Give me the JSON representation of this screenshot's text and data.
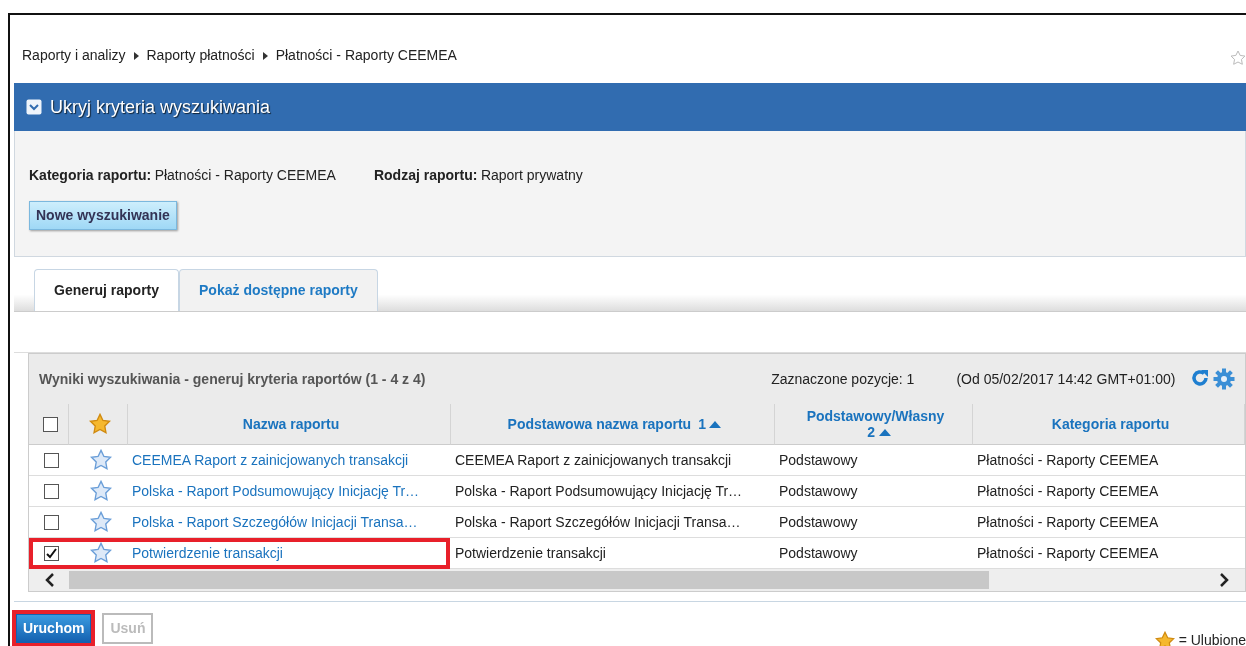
{
  "breadcrumb": [
    "Raporty i analizy",
    "Raporty płatności",
    "Płatności - Raporty CEEMEA"
  ],
  "page_favorite": {
    "on": false
  },
  "criteria_bar": {
    "title": "Ukryj kryteria wyszukiwania",
    "expanded": true
  },
  "criteria": [
    {
      "label": "Kategoria raportu:",
      "value": "Płatności - Raporty CEEMEA"
    },
    {
      "label": "Rodzaj raportu:",
      "value": "Raport prywatny"
    }
  ],
  "new_search_button": "Nowe wyszukiwanie",
  "tabs": [
    {
      "label": "Generuj raporty",
      "selected": true
    },
    {
      "label": "Pokaż dostępne raporty",
      "selected": false
    }
  ],
  "results": {
    "title": "Wyniki wyszukiwania - generuj kryteria raportów (1 - 4 z 4)",
    "selected_count": "Zaznaczone pozycje: 1",
    "as_of": "(Od 05/02/2017 14:42 GMT+01:00)",
    "columns": [
      {
        "label": "Nazwa raportu"
      },
      {
        "label": "Podstawowa nazwa raportu",
        "sort": "1"
      },
      {
        "label": "Podstawowy/Własny",
        "sort": "2"
      },
      {
        "label": "Kategoria raportu"
      }
    ],
    "header_checked": false,
    "rows": [
      {
        "checked": false,
        "favorite": false,
        "annotated": false,
        "cells": [
          "CEEMEA Raport z zainicjowanych transakcji",
          "CEEMEA Raport z zainicjowanych transakcji",
          "Podstawowy",
          "Płatności - Raporty CEEMEA"
        ]
      },
      {
        "checked": false,
        "favorite": false,
        "annotated": false,
        "cells": [
          "Polska - Raport Podsumowujący Inicjację Tr…",
          "Polska - Raport Podsumowujący Inicjację Tr…",
          "Podstawowy",
          "Płatności - Raporty CEEMEA"
        ]
      },
      {
        "checked": false,
        "favorite": false,
        "annotated": false,
        "cells": [
          "Polska - Raport Szczegółów Inicjacji Transa…",
          "Polska - Raport Szczegółów Inicjacji Transa…",
          "Podstawowy",
          "Płatności - Raporty CEEMEA"
        ]
      },
      {
        "checked": true,
        "favorite": false,
        "annotated": true,
        "cells": [
          "Potwierdzenie transakcji",
          "Potwierdzenie transakcji",
          "Podstawowy",
          "Płatności - Raporty CEEMEA"
        ]
      }
    ]
  },
  "actions": [
    {
      "label": "Uruchom",
      "disabled": false,
      "annotated": true
    },
    {
      "label": "Usuń",
      "disabled": true,
      "annotated": false
    }
  ],
  "legend": "= Ulubione"
}
